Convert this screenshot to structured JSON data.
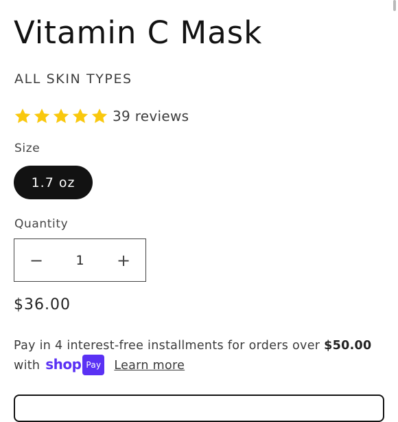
{
  "product": {
    "title": "Vitamin C Mask",
    "subtitle": "ALL SKIN TYPES",
    "rating": {
      "stars": 5,
      "max_stars": 5,
      "reviews_text": "39 reviews",
      "star_color": "#F9C80E"
    }
  },
  "size": {
    "label": "Size",
    "options": [
      "1.7 oz"
    ],
    "selected": "1.7 oz"
  },
  "quantity": {
    "label": "Quantity",
    "value": "1",
    "decrement_symbol": "−",
    "increment_symbol": "+"
  },
  "price": "$36.00",
  "installments": {
    "text_before": "Pay in 4 interest-free installments for orders over",
    "threshold": "$50.00",
    "with_text": "with",
    "shop_logo": "shop",
    "pay_badge": "Pay",
    "learn_more": "Learn more",
    "brand_color": "#5A31F4"
  }
}
